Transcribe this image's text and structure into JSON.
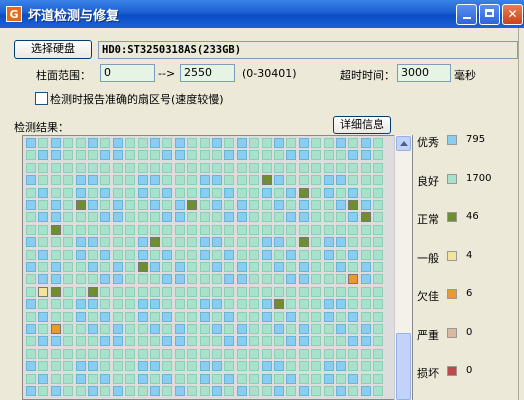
{
  "window": {
    "title": "坏道检测与修复",
    "icon_letter": "G"
  },
  "drive": {
    "button_label": "选择硬盘",
    "selected": "HD0:ST3250318AS(233GB)"
  },
  "cylinder": {
    "label": "柱面范围：",
    "from": "0",
    "arrow": "-->",
    "to": "2550",
    "range_hint": "(0-30401)"
  },
  "timeout": {
    "label": "超时时间：",
    "value": "3000",
    "unit": "毫秒"
  },
  "option": {
    "label": "检测时报告准确的扇区号(速度较慢)",
    "checked": false
  },
  "results": {
    "label": "检测结果：",
    "detail_button": "详细信息"
  },
  "colors": {
    "excellent": "#87cef0",
    "good": "#a6e2cc",
    "normal": "#6f8f2e",
    "fair": "#f4e39a",
    "poor": "#eb9a2a",
    "severe": "#d8b9a2",
    "damaged": "#c0484a"
  },
  "grid": {
    "cols": 29,
    "rows": 21,
    "special": [
      {
        "r": 5,
        "c": 4,
        "t": "normal"
      },
      {
        "r": 5,
        "c": 13,
        "t": "normal"
      },
      {
        "r": 5,
        "c": 26,
        "t": "normal"
      },
      {
        "r": 3,
        "c": 19,
        "t": "normal"
      },
      {
        "r": 4,
        "c": 22,
        "t": "normal"
      },
      {
        "r": 6,
        "c": 27,
        "t": "normal"
      },
      {
        "r": 7,
        "c": 2,
        "t": "normal"
      },
      {
        "r": 8,
        "c": 10,
        "t": "normal"
      },
      {
        "r": 8,
        "c": 22,
        "t": "normal"
      },
      {
        "r": 10,
        "c": 9,
        "t": "normal"
      },
      {
        "r": 12,
        "c": 2,
        "t": "normal"
      },
      {
        "r": 12,
        "c": 5,
        "t": "normal"
      },
      {
        "r": 13,
        "c": 20,
        "t": "normal"
      },
      {
        "r": 11,
        "c": 26,
        "t": "poor"
      },
      {
        "r": 15,
        "c": 2,
        "t": "poor"
      },
      {
        "r": 12,
        "c": 1,
        "t": "fair"
      }
    ]
  },
  "legend": [
    {
      "name": "优秀",
      "key": "excellent",
      "count": "795"
    },
    {
      "name": "良好",
      "key": "good",
      "count": "1700"
    },
    {
      "name": "正常",
      "key": "normal",
      "count": "46"
    },
    {
      "name": "一般",
      "key": "fair",
      "count": "4"
    },
    {
      "name": "欠佳",
      "key": "poor",
      "count": "6"
    },
    {
      "name": "严重",
      "key": "severe",
      "count": "0"
    },
    {
      "name": "损坏",
      "key": "damaged",
      "count": "0"
    }
  ]
}
